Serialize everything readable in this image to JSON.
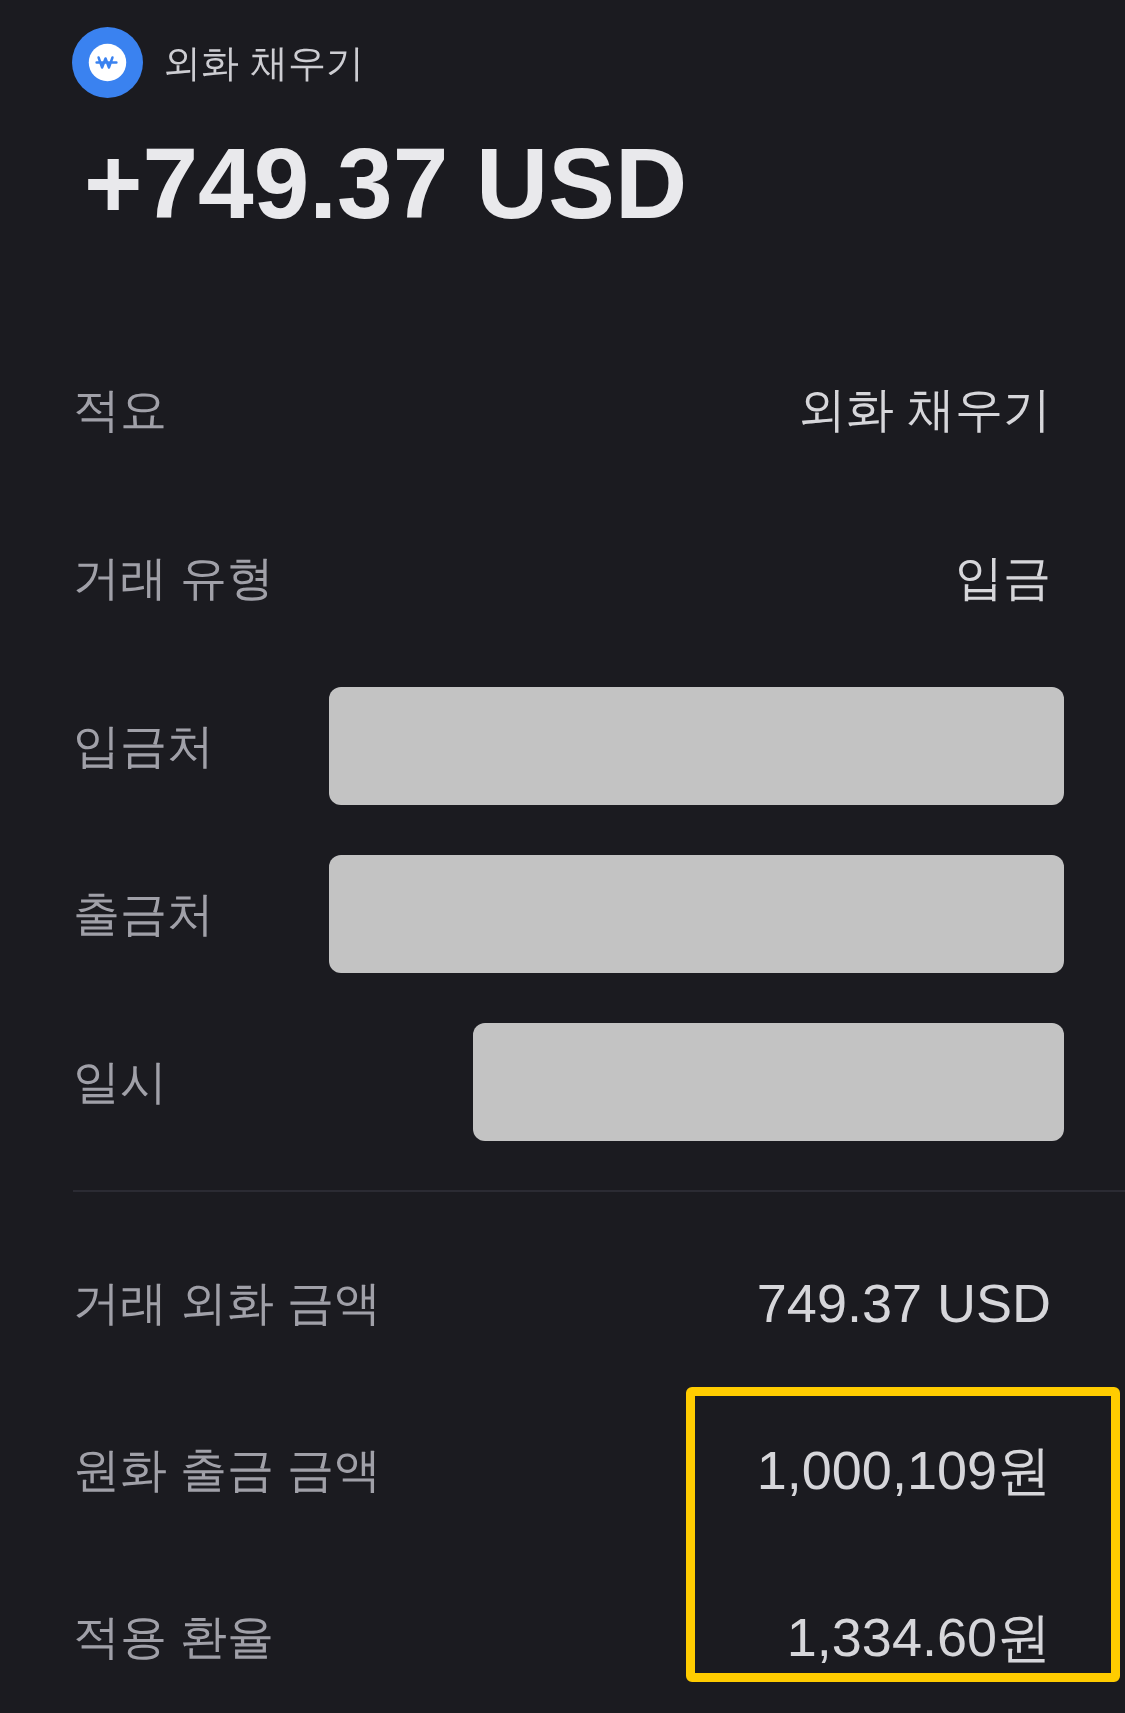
{
  "header": {
    "title": "외화 채우기",
    "amount": "+749.37 USD"
  },
  "details": [
    {
      "label": "적요",
      "kind": "text",
      "value": "외화 채우기"
    },
    {
      "label": "거래 유형",
      "kind": "text",
      "value": "입금"
    },
    {
      "label": "입금처",
      "kind": "redacted"
    },
    {
      "label": "출금처",
      "kind": "redacted"
    },
    {
      "label": "일시",
      "kind": "redacted"
    }
  ],
  "amounts": [
    {
      "label": "거래 외화 금액",
      "value": "749.37 USD",
      "highlighted": false
    },
    {
      "label": "원화 출금 금액",
      "value": "1,000,109원",
      "highlighted": true
    },
    {
      "label": "적용 환율",
      "value": "1,334.60원",
      "highlighted": true
    }
  ]
}
